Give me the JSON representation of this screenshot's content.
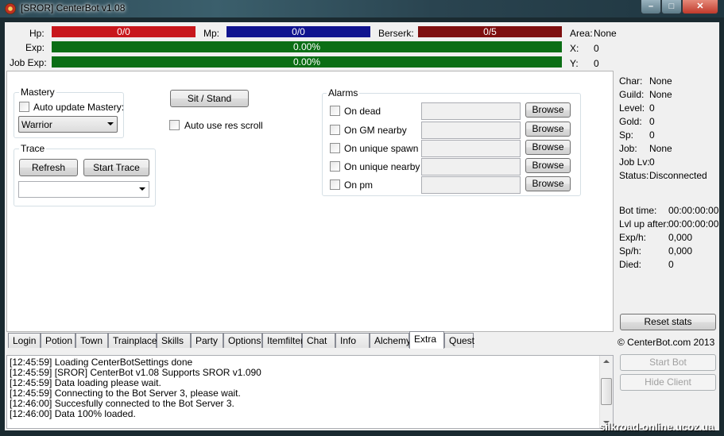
{
  "window": {
    "title": "[SROR] CenterBot v1.08",
    "min": "–",
    "max": "□",
    "close": "✕"
  },
  "bars": {
    "hp": {
      "label": "Hp:",
      "value": "0/0",
      "color": "#c8171c"
    },
    "mp": {
      "label": "Mp:",
      "value": "0/0",
      "color": "#10148f"
    },
    "berserk": {
      "label": "Berserk:",
      "value": "0/5",
      "color": "#7e0f0f"
    },
    "exp": {
      "label": "Exp:",
      "value": "0.00%",
      "color": "#0b6e15"
    },
    "jobexp": {
      "label": "Job Exp:",
      "value": "0.00%",
      "color": "#0b6e15"
    }
  },
  "location": {
    "area_label": "Area:",
    "area_value": "None",
    "x_label": "X:",
    "x_value": "0",
    "y_label": "Y:",
    "y_value": "0"
  },
  "char_info": [
    {
      "label": "Char:",
      "value": "None"
    },
    {
      "label": "Guild:",
      "value": "None"
    },
    {
      "label": "Level:",
      "value": "0"
    },
    {
      "label": "Gold:",
      "value": "0"
    },
    {
      "label": "Sp:",
      "value": "0"
    },
    {
      "label": "Job:",
      "value": "None"
    },
    {
      "label": "Job Lv:",
      "value": "0"
    },
    {
      "label": "Status:",
      "value": "Disconnected"
    }
  ],
  "stats": [
    {
      "label": "Bot time:",
      "value": "00:00:00:00"
    },
    {
      "label": "Lvl up after:",
      "value": "00:00:00:00"
    },
    {
      "label": "Exp/h:",
      "value": "0,000"
    },
    {
      "label": "Sp/h:",
      "value": "0,000"
    },
    {
      "label": "Died:",
      "value": "0"
    }
  ],
  "mastery": {
    "title": "Mastery",
    "auto_update_label": "Auto update Mastery:",
    "selected": "Warrior"
  },
  "trace": {
    "title": "Trace",
    "refresh": "Refresh",
    "start": "Start Trace",
    "selected": ""
  },
  "sit_stand": "Sit / Stand",
  "auto_res_scroll": "Auto use res scroll",
  "alarms": {
    "title": "Alarms",
    "browse": "Browse",
    "items": [
      {
        "label": "On dead"
      },
      {
        "label": "On GM nearby"
      },
      {
        "label": "On unique spawn"
      },
      {
        "label": "On unique nearby"
      },
      {
        "label": "On pm"
      }
    ]
  },
  "tabs": [
    "Login",
    "Potion",
    "Town",
    "Trainplace",
    "Skills",
    "Party",
    "Options",
    "Itemfilter",
    "Chat",
    "Info",
    "Alchemy",
    "Extra",
    "Quest"
  ],
  "active_tab": "Extra",
  "log": [
    "[12:45:59] Loading CenterBotSettings done",
    "[12:45:59] [SROR] CenterBot v1.08 Supports SROR v1.090",
    "[12:45:59] Data loading please wait.",
    "[12:45:59] Connecting to the Bot Server 3, please wait.",
    "[12:46:00] Succesfully connected to the Bot Server 3.",
    "[12:46:00] Data 100% loaded."
  ],
  "reset_stats": "Reset stats",
  "copyright": "© CenterBot.com 2013",
  "start_bot": "Start Bot",
  "hide_client": "Hide Client",
  "watermark": "silkroad-online.ucoz.ua"
}
